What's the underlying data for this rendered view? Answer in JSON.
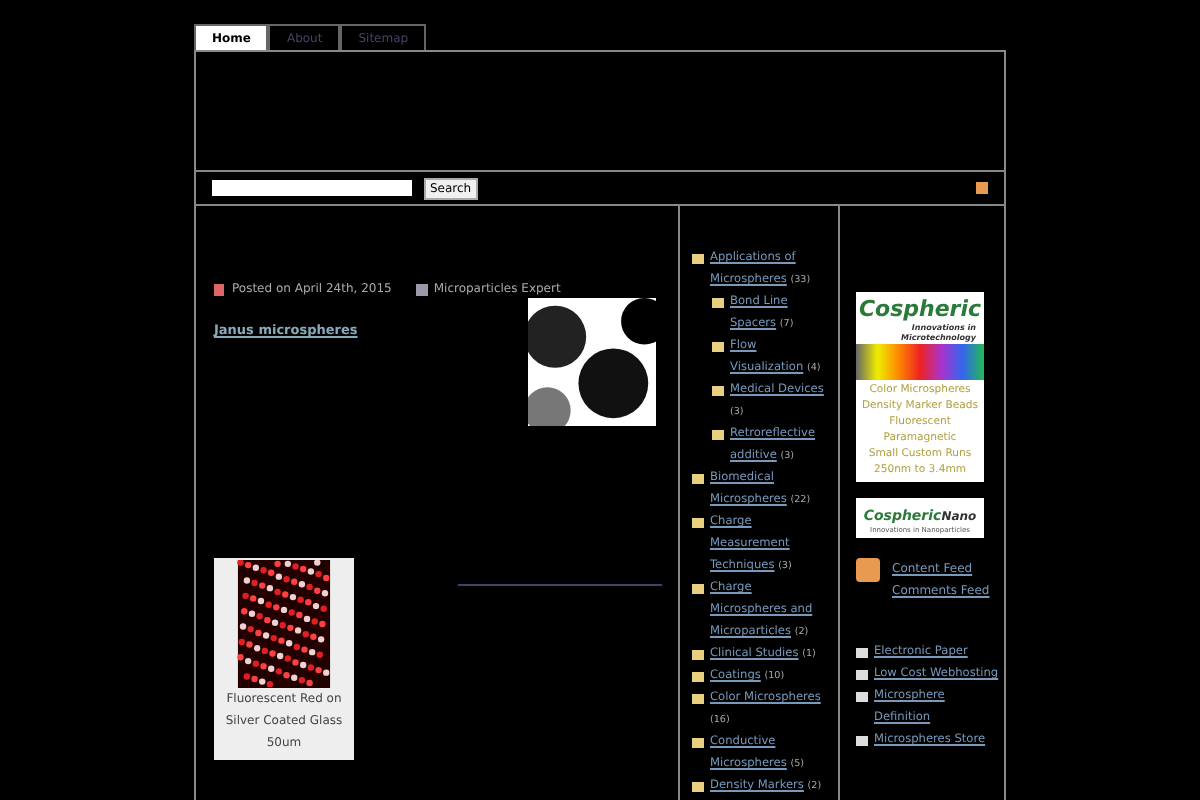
{
  "nav": {
    "tabs": [
      {
        "label": "Home",
        "selected": true
      },
      {
        "label": "About",
        "selected": false
      },
      {
        "label": "Sitemap",
        "selected": false
      }
    ]
  },
  "search": {
    "button": "Search"
  },
  "post": {
    "date": "Posted on April 24th, 2015",
    "author": "Microparticles Expert",
    "title": "Janus microspheres",
    "caption": [
      "Fluorescent Red on",
      "Silver Coated Glass",
      "50um"
    ]
  },
  "categories": [
    {
      "label": "Applications of Microspheres",
      "count": "(33)",
      "children": [
        {
          "label": "Bond Line Spacers",
          "count": "(7)"
        },
        {
          "label": "Flow Visualization",
          "count": "(4)"
        },
        {
          "label": "Medical Devices",
          "count": "(3)"
        },
        {
          "label": "Retroreflective additive",
          "count": "(3)"
        }
      ]
    },
    {
      "label": "Biomedical Microspheres",
      "count": "(22)"
    },
    {
      "label": "Charge Measurement Techniques",
      "count": "(3)"
    },
    {
      "label": "Charge Microspheres and Microparticles",
      "count": "(2)"
    },
    {
      "label": "Clinical Studies",
      "count": "(1)"
    },
    {
      "label": "Coatings",
      "count": "(10)"
    },
    {
      "label": "Color Microspheres",
      "count": "(16)"
    },
    {
      "label": "Conductive Microspheres",
      "count": "(5)"
    },
    {
      "label": "Density Markers",
      "count": "(2)"
    }
  ],
  "ad": {
    "brand": "Cospheric",
    "tagline": "Innovations in Microtechnology",
    "lines": [
      "Color Microspheres",
      "Density Marker Beads",
      "Fluorescent",
      "Paramagnetic",
      "Small Custom Runs",
      "250nm to 3.4mm"
    ]
  },
  "ad2": {
    "brand": "Cospheric",
    "suffix": "Nano",
    "tagline": "Innovations in Nanoparticles"
  },
  "feeds": [
    "Content Feed",
    "Comments Feed"
  ],
  "links": [
    "Electronic Paper",
    "Low Cost Webhosting",
    "Microsphere Definition",
    "Microspheres Store"
  ]
}
